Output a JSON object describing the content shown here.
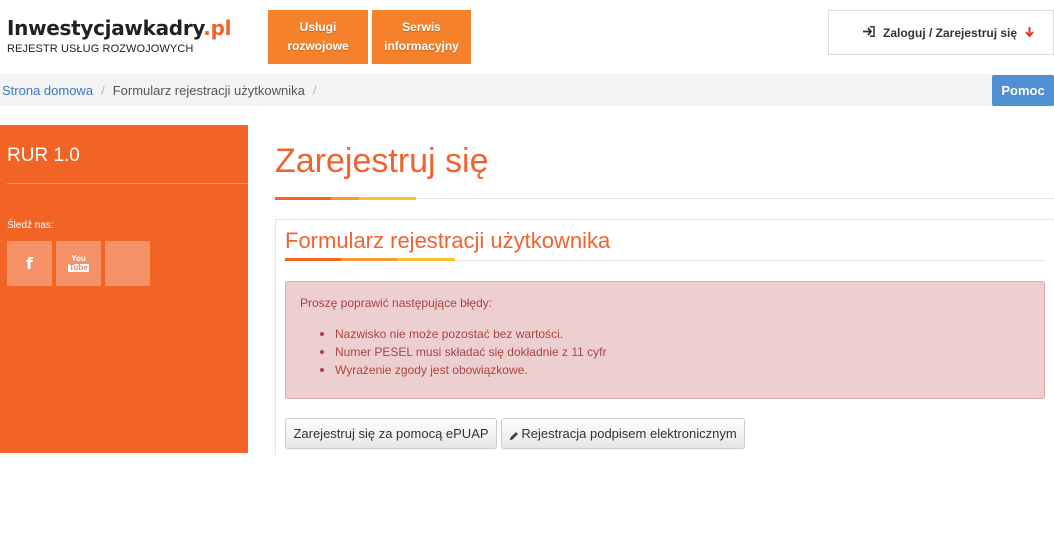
{
  "header": {
    "logo_main": "Inwestycjawkadry",
    "logo_tld": ".pl",
    "logo_sub": "REJESTR USŁUG ROZWOJOWYCH",
    "nav": [
      {
        "line1": "Usługi",
        "line2": "rozwojowe"
      },
      {
        "line1": "Serwis",
        "line2": "informacyjny"
      }
    ],
    "login_label": "Zaloguj / Zarejestruj się",
    "login_icon": "sign-in-icon",
    "dropdown_icon": "arrow-down-icon"
  },
  "breadcrumb": {
    "home": "Strona domowa",
    "current": "Formularz rejestracji użytkownika",
    "separator": "/"
  },
  "help_button": "Pomoc",
  "sidebar": {
    "title": "RUR 1.0",
    "follow_label": "Śledź nas:",
    "social": [
      {
        "icon": "facebook-icon",
        "label": "f"
      },
      {
        "icon": "youtube-icon",
        "label_top": "You",
        "label_bottom": "Tube"
      },
      {
        "icon": "empty-social-icon"
      }
    ]
  },
  "main": {
    "page_title": "Zarejestruj się",
    "form_title": "Formularz rejestracji użytkownika",
    "alert": {
      "heading": "Proszę poprawić następujące błędy:",
      "errors": [
        "Nazwisko nie może pozostać bez wartości.",
        "Numer PESEL musi składać się dokładnie z 11 cyfr",
        "Wyrażenie zgody jest obowiązkowe."
      ]
    },
    "buttons": {
      "epuap": "Zarejestruj się za pomocą ePUAP",
      "signature": "Rejestracja podpisem elektronicznym"
    }
  },
  "colors": {
    "brand_orange": "#f26326",
    "nav_orange": "#f5822b",
    "accent_mid": "#f39a3c",
    "accent_yellow": "#f6c22b",
    "link_blue": "#3a79c4",
    "help_blue": "#4f8fd2",
    "error_bg": "#eecfd0",
    "error_text": "#a94442"
  }
}
